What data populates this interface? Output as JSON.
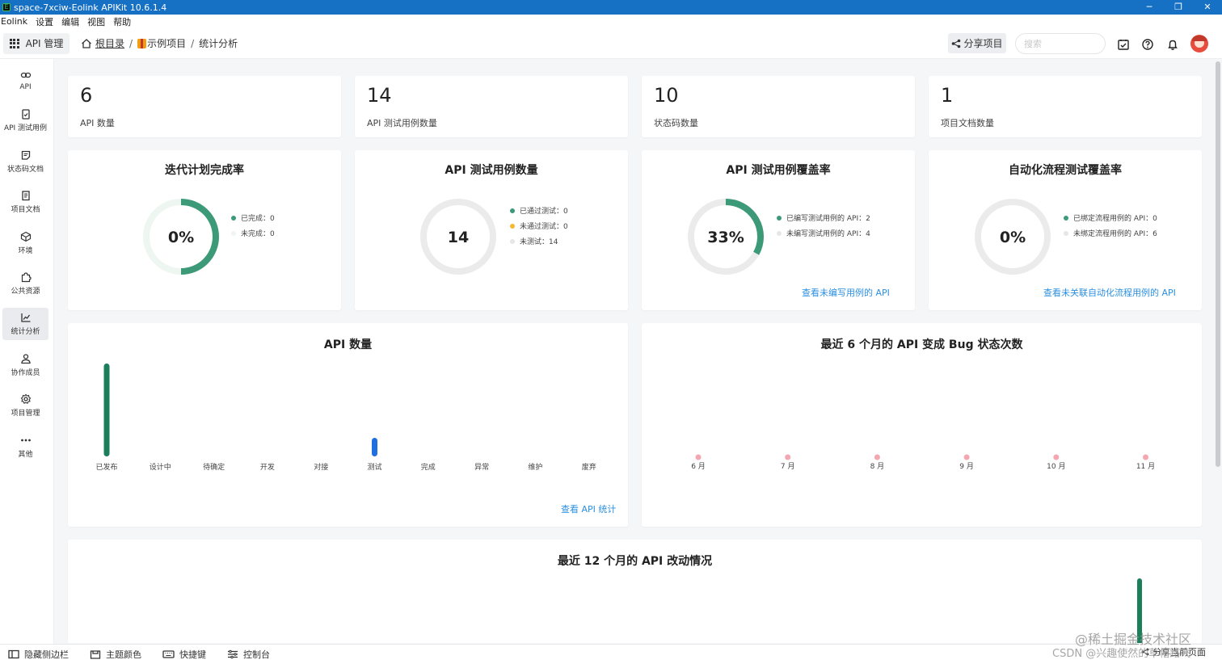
{
  "titlebar": {
    "title": "space-7xciw-Eolink APIKit 10.6.1.4",
    "min": "─",
    "max": "❐",
    "close": "✕"
  },
  "menubar": [
    "Eolink",
    "设置",
    "编辑",
    "视图",
    "帮助"
  ],
  "topbar": {
    "api_manage": "API 管理",
    "breadcrumb": {
      "root": "根目录",
      "project": "示例项目",
      "page": "统计分析",
      "sep": "/"
    },
    "share_label": "分享项目",
    "search_placeholder": "搜索"
  },
  "sidebar": [
    {
      "label": "API",
      "icon": "link-icon"
    },
    {
      "label": "API 测试用例",
      "icon": "clipboard-check-icon"
    },
    {
      "label": "状态码文档",
      "icon": "code-doc-icon"
    },
    {
      "label": "项目文档",
      "icon": "document-icon"
    },
    {
      "label": "环境",
      "icon": "cube-icon"
    },
    {
      "label": "公共资源",
      "icon": "puzzle-icon"
    },
    {
      "label": "统计分析",
      "icon": "chart-line-icon",
      "active": true
    },
    {
      "label": "协作成员",
      "icon": "user-icon"
    },
    {
      "label": "项目管理",
      "icon": "gear-icon"
    },
    {
      "label": "其他",
      "icon": "more-icon"
    }
  ],
  "stats": [
    {
      "value": "6",
      "label": "API 数量"
    },
    {
      "value": "14",
      "label": "API 测试用例数量"
    },
    {
      "value": "10",
      "label": "状态码数量"
    },
    {
      "value": "1",
      "label": "项目文档数量"
    }
  ],
  "gauges": [
    {
      "title": "迭代计划完成率",
      "center": "0%",
      "fraction": 0,
      "legend": [
        {
          "text": "已完成：0",
          "color": "#3d9a79"
        },
        {
          "text": "未完成：0",
          "color": "#eef5f1"
        }
      ],
      "link": ""
    },
    {
      "title": "API 测试用例数量",
      "center": "14",
      "fraction": 0,
      "legend": [
        {
          "text": "已通过测试：0",
          "color": "#3d9a79"
        },
        {
          "text": "未通过测试：0",
          "color": "#f5b82e"
        },
        {
          "text": "未测试：14",
          "color": "#e6e6e6"
        }
      ],
      "link": ""
    },
    {
      "title": "API 测试用例覆盖率",
      "center": "33%",
      "fraction": 0.33,
      "legend": [
        {
          "text": "已编写测试用例的 API：2",
          "color": "#3d9a79"
        },
        {
          "text": "未编写测试用例的 API：4",
          "color": "#e6e6e6"
        }
      ],
      "link": "查看未编写用例的 API"
    },
    {
      "title": "自动化流程测试覆盖率",
      "center": "0%",
      "fraction": 0,
      "legend": [
        {
          "text": "已绑定流程用例的 API：0",
          "color": "#3d9a79"
        },
        {
          "text": "未绑定流程用例的 API：6",
          "color": "#e6e6e6"
        }
      ],
      "link": "查看未关联自动化流程用例的 API"
    }
  ],
  "chart_data": [
    {
      "type": "bar",
      "title": "API 数量",
      "categories": [
        "已发布",
        "设计中",
        "待确定",
        "开发",
        "对接",
        "测试",
        "完成",
        "异常",
        "维护",
        "废弃"
      ],
      "values": [
        5,
        0,
        0,
        0,
        0,
        1,
        0,
        0,
        0,
        0
      ],
      "colors": [
        "#1a7f5a",
        null,
        null,
        null,
        null,
        "#1f6fe0",
        null,
        null,
        null,
        null
      ],
      "ylim": [
        0,
        5
      ],
      "link": "查看 API 统计"
    },
    {
      "type": "scatter",
      "title": "最近 6 个月的 API 变成 Bug 状态次数",
      "categories": [
        "6 月",
        "7 月",
        "8 月",
        "9 月",
        "10 月",
        "11 月"
      ],
      "values": [
        0,
        0,
        0,
        0,
        0,
        0
      ],
      "color": "#f4a7b0"
    },
    {
      "type": "bar",
      "title": "最近 12 个月的 API 改动情况",
      "categories": [],
      "values": [],
      "color": "#1a7f5a"
    }
  ],
  "bottombar": [
    {
      "label": "隐藏侧边栏",
      "icon": "sidebar-toggle-icon"
    },
    {
      "label": "主题颜色",
      "icon": "theme-icon"
    },
    {
      "label": "快捷键",
      "icon": "keyboard-icon"
    },
    {
      "label": "控制台",
      "icon": "console-icon"
    }
  ],
  "share_page": "分享当前页面",
  "watermark": {
    "line1": "@稀土掘金技术社区",
    "line2": "CSDN @兴趣使然的草帽路飞"
  }
}
